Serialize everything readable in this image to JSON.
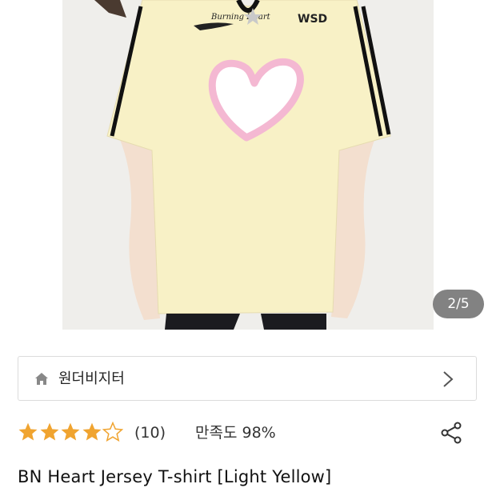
{
  "gallery": {
    "counter": "2/5",
    "photo_subject": "light yellow oversized jersey t-shirt with pink flame heart print and black side stripes",
    "shirt_print_text": "Burning Heart",
    "logo_text": "WSD"
  },
  "store": {
    "icon": "home-icon",
    "name": "원더비지터",
    "chevron_icon": "chevron-right-icon"
  },
  "rating": {
    "stars": 4.5,
    "max": 5,
    "star_color": "#f0a430",
    "count": "(10)",
    "satisfaction": "만족도 98%",
    "share_icon": "share-icon"
  },
  "product": {
    "title": "BN Heart Jersey T-shirt [Light Yellow]"
  },
  "colors": {
    "shirt": "#f8f1c6",
    "heart": "#f4b8d2",
    "stripe": "#111111"
  }
}
